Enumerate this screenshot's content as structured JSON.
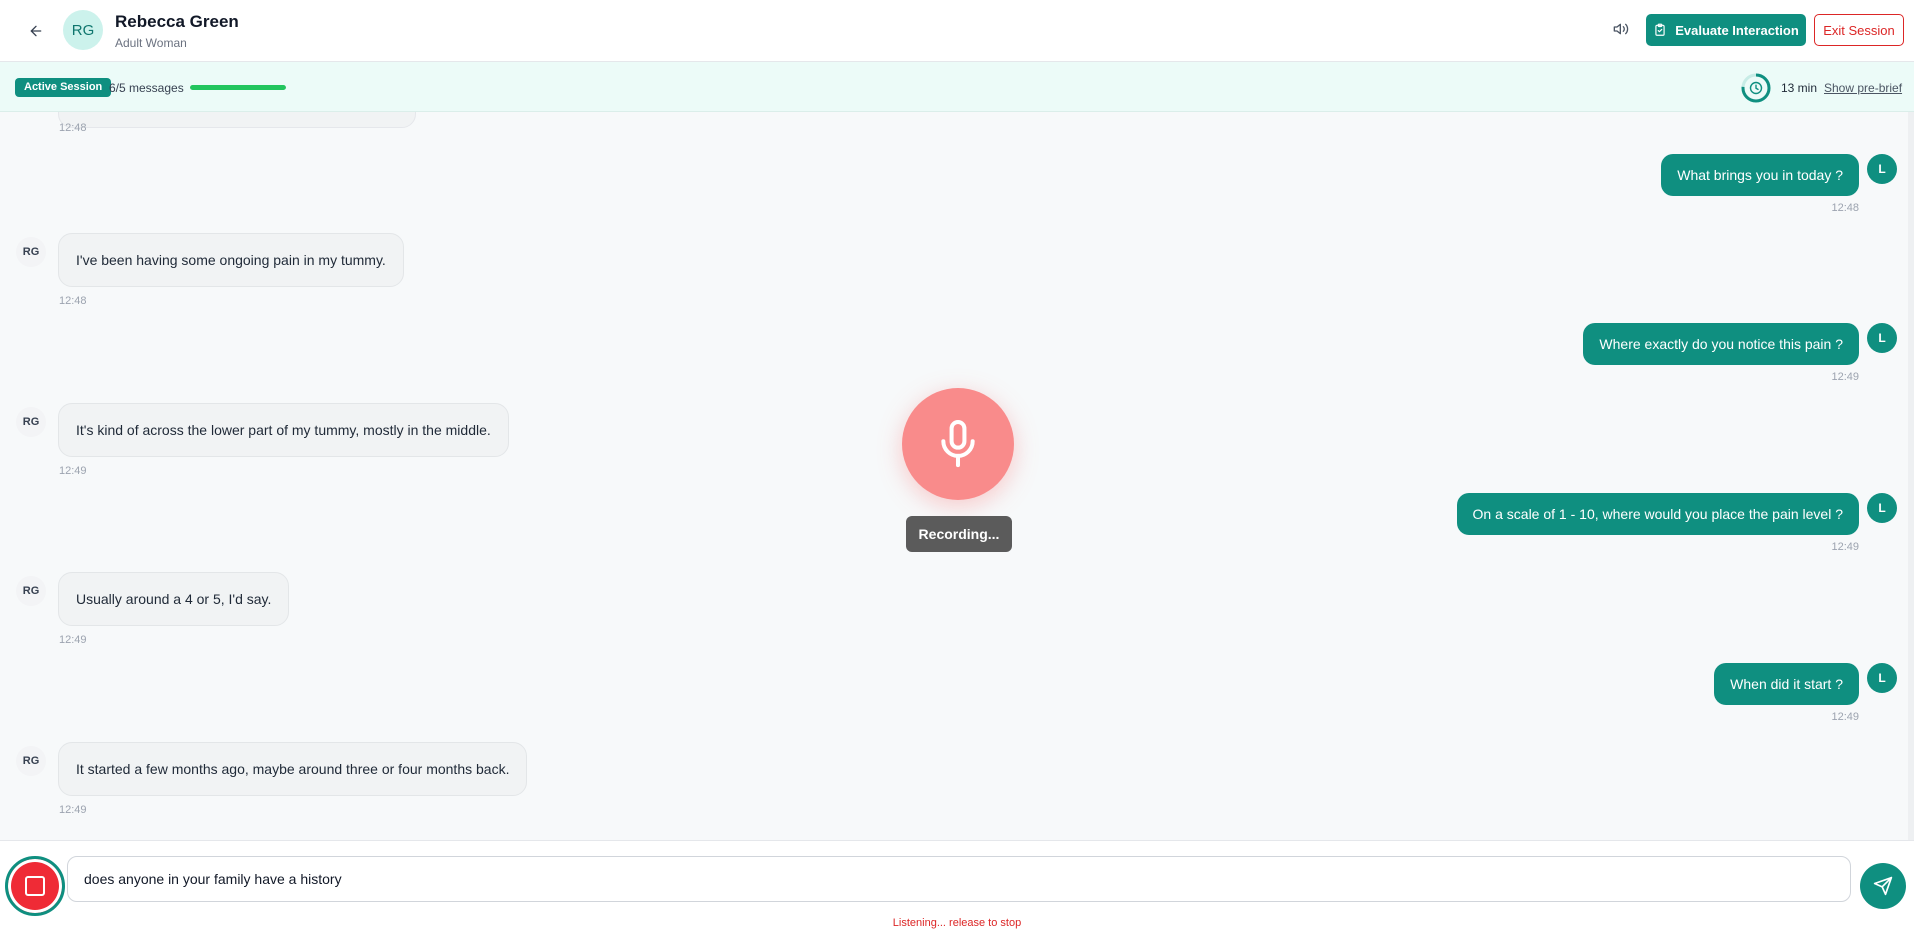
{
  "header": {
    "avatar_initials": "RG",
    "name": "Rebecca Green",
    "subtitle": "Adult Woman",
    "evaluate_label": "Evaluate Interaction",
    "exit_label": "Exit Session"
  },
  "status": {
    "badge": "Active Session",
    "message_count": "6/5 messages",
    "progress": 1.0,
    "timer": "13 min",
    "prebrief_link": "Show pre-brief"
  },
  "chat": {
    "first_timestamp": "12:48",
    "messages": [
      {
        "sender": "user",
        "initial": "L",
        "text": "What brings you in today ?",
        "time": "12:48"
      },
      {
        "sender": "bot",
        "initial": "RG",
        "text": "I've been having some ongoing pain in my tummy.",
        "time": "12:48"
      },
      {
        "sender": "user",
        "initial": "L",
        "text": "Where exactly do you notice this pain ?",
        "time": "12:49"
      },
      {
        "sender": "bot",
        "initial": "RG",
        "text": "It's kind of across the lower part of my tummy, mostly in the middle.",
        "time": "12:49"
      },
      {
        "sender": "user",
        "initial": "L",
        "text": "On a scale of 1 - 10, where would you place the pain level ?",
        "time": "12:49"
      },
      {
        "sender": "bot",
        "initial": "RG",
        "text": "Usually around a 4 or 5, I'd say.",
        "time": "12:49"
      },
      {
        "sender": "user",
        "initial": "L",
        "text": "When did it start ?",
        "time": "12:49"
      },
      {
        "sender": "bot",
        "initial": "RG",
        "text": "It started a few months ago, maybe around three or four months back.",
        "time": "12:49"
      }
    ]
  },
  "recording": {
    "label": "Recording..."
  },
  "input": {
    "value": "does anyone in your family have a history",
    "listening_text": "Listening... release to stop"
  },
  "icons": {
    "back": "arrow-left-icon",
    "speaker": "speaker-icon",
    "evaluate": "clipboard-check-icon",
    "timer": "clock-icon",
    "mic": "microphone-icon",
    "stop": "stop-icon",
    "send": "send-icon"
  },
  "colors": {
    "accent": "#0f8f80",
    "danger": "#dc2626",
    "recording": "#f98b8b",
    "progress": "#22c55e"
  }
}
